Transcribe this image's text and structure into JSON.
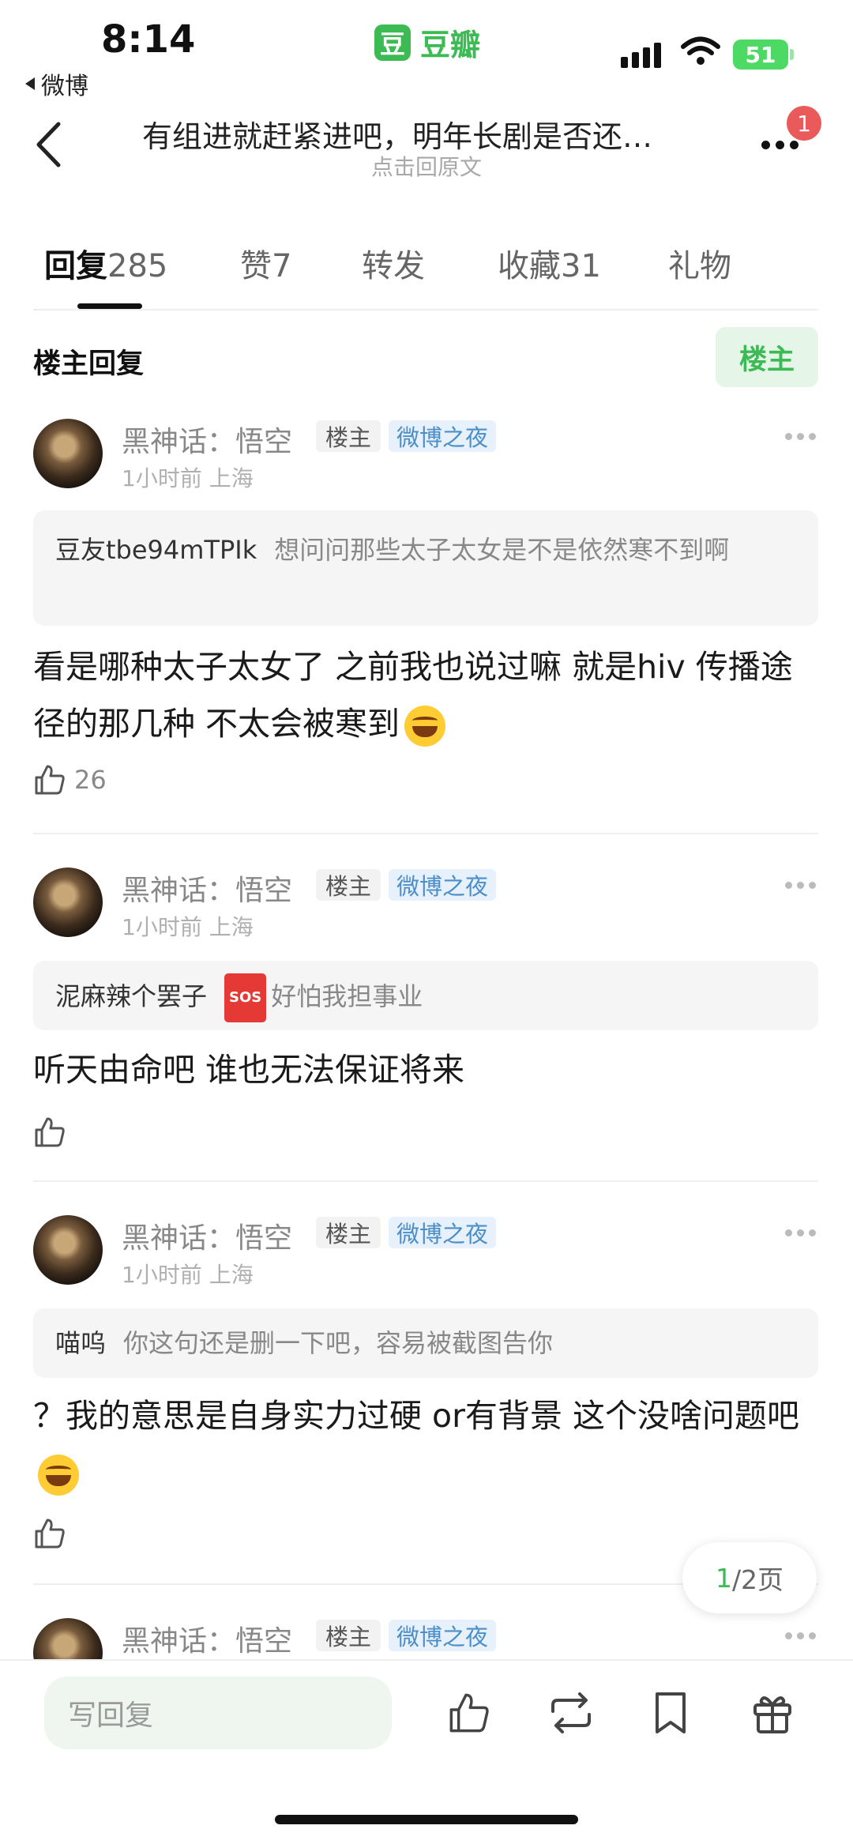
{
  "status_bar": {
    "time": "8:14",
    "back_app_label": "微博",
    "brand_logo_char": "豆",
    "brand_name": "豆瓣",
    "battery": "51"
  },
  "header": {
    "title": "有组进就赶紧进吧，明年长剧是否还…",
    "subtitle": "点击回原文",
    "notification_count": "1"
  },
  "tabs": [
    {
      "label": "回复",
      "count": "285",
      "active": true
    },
    {
      "label": "赞",
      "count": "7"
    },
    {
      "label": "转发",
      "count": ""
    },
    {
      "label": "收藏",
      "count": "31"
    },
    {
      "label": "礼物",
      "count": ""
    }
  ],
  "section": {
    "title": "楼主回复",
    "filter_button": "楼主"
  },
  "comments": [
    {
      "username": "黑神话：悟空",
      "op_tag": "楼主",
      "badge": "微博之夜",
      "time": "1小时前",
      "location": "上海",
      "quote_user": "豆友tbe94mTPIk",
      "quote_text": "想问问那些太子太女是不是依然寒不到啊",
      "text": "看是哪种太子太女了 之前我也说过嘛 就是hiv 传播途径的那几种 不太会被寒到",
      "likes": "26"
    },
    {
      "username": "黑神话：悟空",
      "op_tag": "楼主",
      "badge": "微博之夜",
      "time": "1小时前",
      "location": "上海",
      "quote_user": "泥麻辣个罢子",
      "quote_text": "好怕我担事业",
      "text": "听天由命吧 谁也无法保证将来",
      "likes": ""
    },
    {
      "username": "黑神话：悟空",
      "op_tag": "楼主",
      "badge": "微博之夜",
      "time": "1小时前",
      "location": "上海",
      "quote_user": "喵呜",
      "quote_text": "你这句还是删一下吧，容易被截图告你",
      "text": "？我的意思是自身实力过硬 or有背景 这个没啥问题吧",
      "likes": ""
    },
    {
      "username": "黑神话：悟空",
      "op_tag": "楼主",
      "badge": "微博之夜"
    }
  ],
  "pager": {
    "current": "1",
    "total_text": "/2页"
  },
  "bottom_bar": {
    "reply_placeholder": "写回复"
  },
  "colors": {
    "brand_green": "#3cba54",
    "badge_blue": "#4b8ec8",
    "notification_red": "#ea5a5a"
  }
}
